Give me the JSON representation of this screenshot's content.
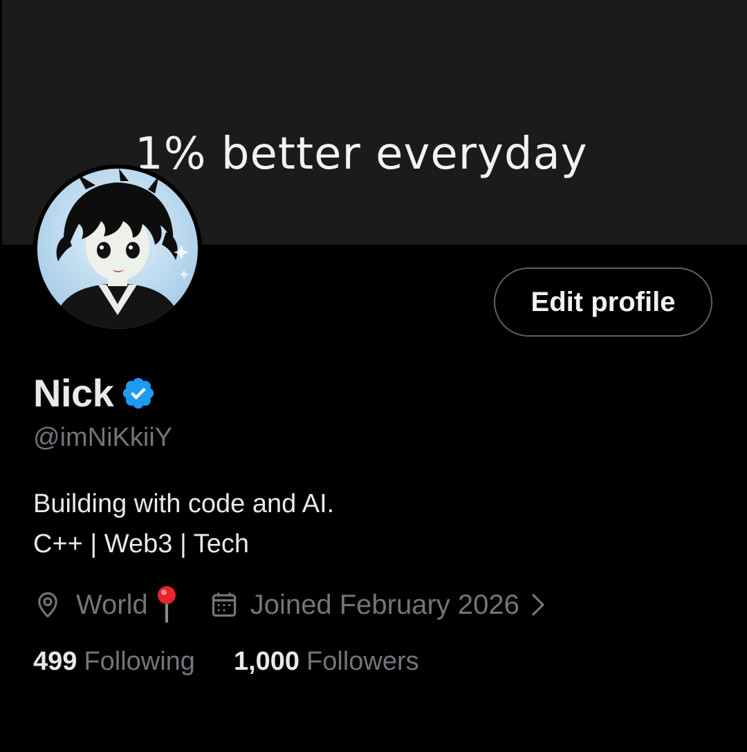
{
  "banner": {
    "text": "1% better everyday",
    "background": "#1b1b1b"
  },
  "avatar": {
    "icon": "anime-avatar"
  },
  "edit_profile": {
    "label": "Edit profile"
  },
  "profile": {
    "name": "Nick",
    "verified_icon": "verified-badge-icon",
    "verified_color": "#1d9bf0",
    "handle": "@imNiKkiiY",
    "bio_line1": "Building with code and AI.",
    "bio_line2": "C++ | Web3 | Tech"
  },
  "meta": {
    "location_icon": "location-icon",
    "location": "World",
    "pin_emoji_icon": "round-pushpin-icon",
    "calendar_icon": "calendar-icon",
    "joined": "Joined February 2026",
    "chevron_icon": "chevron-right-icon"
  },
  "stats": {
    "following_count": "499",
    "following_label": "Following",
    "followers_count": "1,000",
    "followers_label": "Followers"
  },
  "colors": {
    "background": "#000000",
    "text_primary": "#e7e9ea",
    "text_secondary": "#71767b",
    "border": "#536471"
  }
}
